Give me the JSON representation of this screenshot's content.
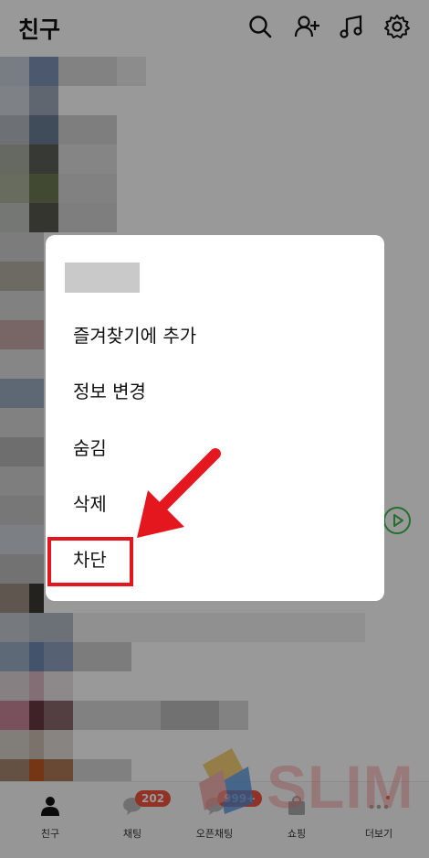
{
  "header": {
    "title": "친구",
    "icons": [
      "search-icon",
      "add-friend-icon",
      "music-icon",
      "settings-icon"
    ]
  },
  "context_menu": {
    "items": [
      {
        "label": "즐겨찾기에 추가"
      },
      {
        "label": "정보 변경"
      },
      {
        "label": "숨김"
      },
      {
        "label": "삭제"
      },
      {
        "label": "차단"
      }
    ],
    "highlighted_item": "차단"
  },
  "bottom_nav": {
    "items": [
      {
        "label": "친구",
        "icon": "person-icon",
        "badge": ""
      },
      {
        "label": "채팅",
        "icon": "chat-bubble-icon",
        "badge": "202"
      },
      {
        "label": "오픈채팅",
        "icon": "open-chat-icon",
        "badge": "999+"
      },
      {
        "label": "쇼핑",
        "icon": "shopping-bag-icon",
        "badge": ""
      },
      {
        "label": "더보기",
        "icon": "more-dots-icon",
        "badge": ""
      }
    ]
  },
  "watermark": {
    "text": "SLIM"
  },
  "colors": {
    "highlight_box": "#e5171e",
    "arrow": "#e5171e",
    "badge": "#f2543f",
    "play_button": "#3bb94a"
  }
}
